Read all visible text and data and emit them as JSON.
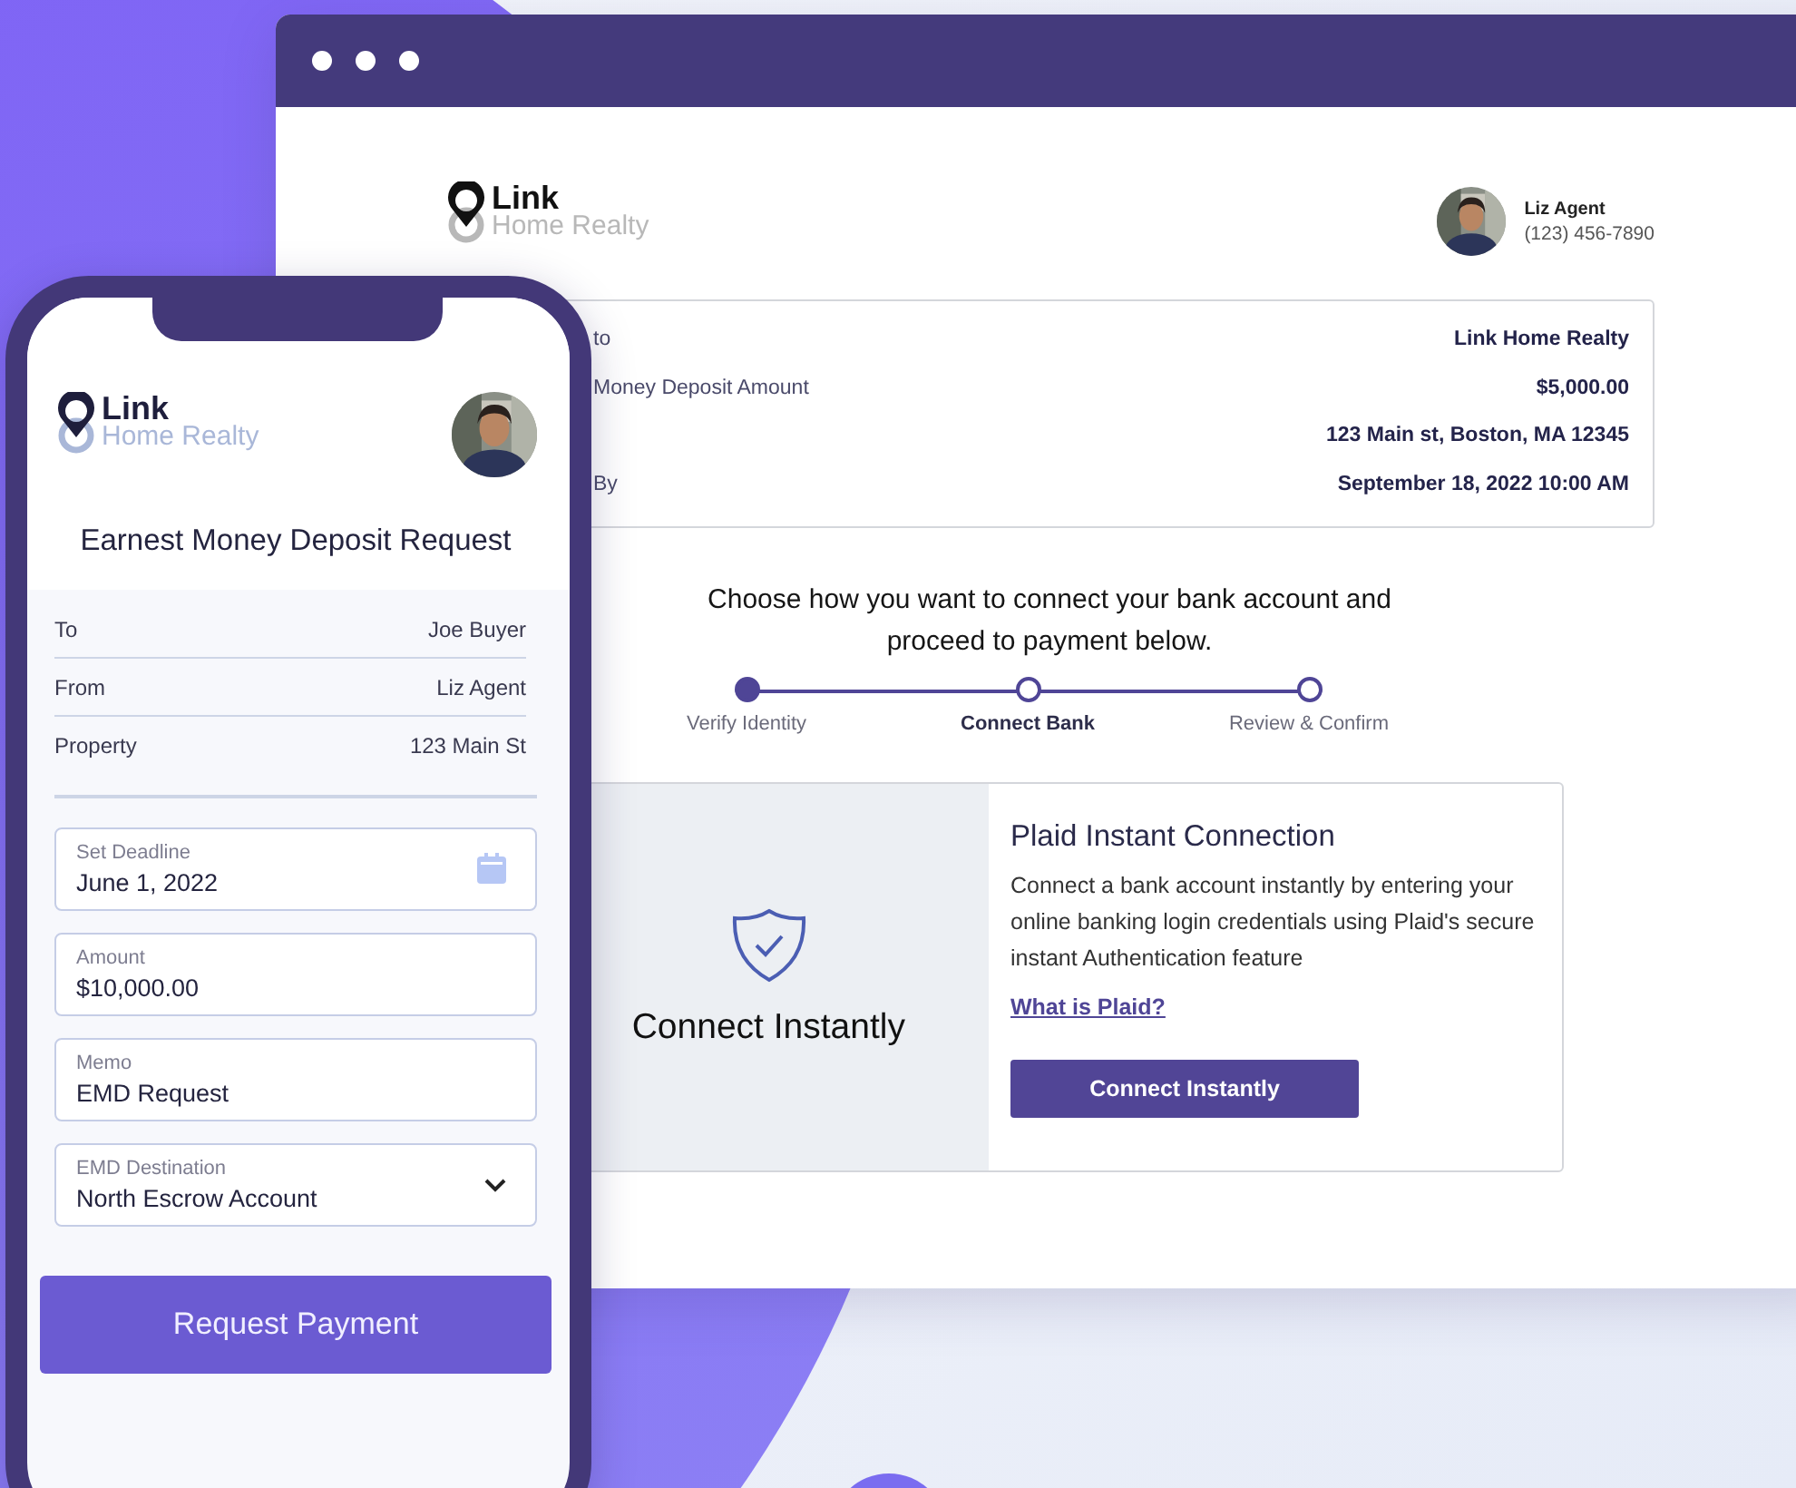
{
  "browser_window": {
    "logo": {
      "name": "Link",
      "tagline": "Home Realty"
    },
    "agent": {
      "name": "Liz Agent",
      "phone": "(123) 456-7890"
    },
    "summary": [
      {
        "label": "to",
        "value": "Link Home Realty"
      },
      {
        "label": "Money Deposit Amount",
        "value": "$5,000.00"
      },
      {
        "value": "123 Main st, Boston, MA 12345"
      },
      {
        "label": "By",
        "value": "September 18, 2022 10:00 AM"
      }
    ],
    "prompt": "Choose how you want to connect your bank account and proceed to payment below.",
    "steps": [
      {
        "label": "Verify Identity",
        "completed": true,
        "selected": false
      },
      {
        "label": "Connect Bank",
        "completed": false,
        "selected": true
      },
      {
        "label": "Review & Confirm",
        "completed": false,
        "selected": false
      }
    ],
    "option": {
      "title": "Connect Instantly",
      "heading": "Plaid Instant Connection",
      "description": "Connect a bank account instantly by entering your online banking login credentials using Plaid's secure instant Authentication feature",
      "link": "What is Plaid?",
      "button": "Connect Instantly"
    }
  },
  "phone": {
    "logo": {
      "name": "Link",
      "tagline": "Home Realty"
    },
    "title": "Earnest Money Deposit Request",
    "details": [
      {
        "label": "To",
        "value": "Joe Buyer"
      },
      {
        "label": "From",
        "value": "Liz Agent"
      },
      {
        "label": "Property",
        "value": "123 Main St"
      }
    ],
    "fields": [
      {
        "kind": "date",
        "label": "Set Deadline",
        "value": "June 1, 2022"
      },
      {
        "kind": "text",
        "label": "Amount",
        "value": "$10,000.00"
      },
      {
        "kind": "text",
        "label": "Memo",
        "value": "EMD Request"
      },
      {
        "kind": "select",
        "label": "EMD Destination",
        "value": "North Escrow Account"
      }
    ],
    "button": "Request Payment"
  }
}
